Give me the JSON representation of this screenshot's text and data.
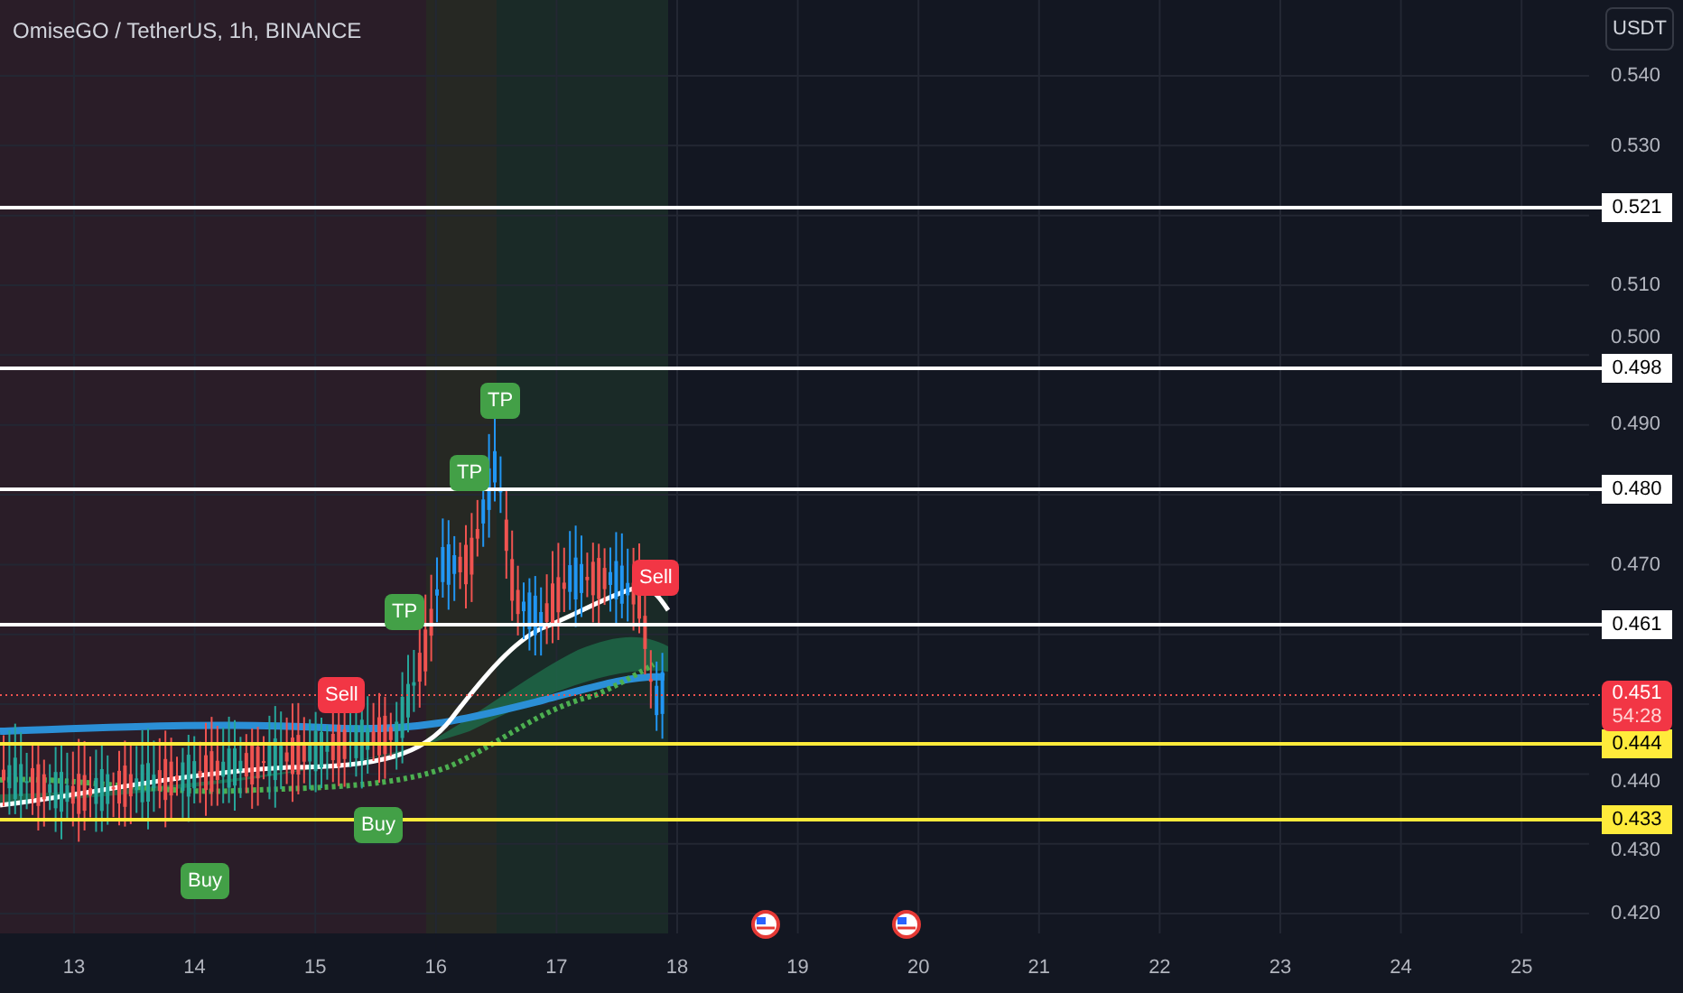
{
  "chart": {
    "title": "OmiseGO / TetherUS, 1h, BINANCE",
    "currency_button": "USDT",
    "price_ticks": [
      "0.540",
      "0.530",
      "0.510",
      "0.500",
      "0.490",
      "0.470",
      "0.440",
      "0.430",
      "0.420"
    ],
    "date_ticks": [
      "13",
      "14",
      "15",
      "16",
      "17",
      "18",
      "19",
      "20",
      "21",
      "22",
      "23",
      "24",
      "25"
    ],
    "levels": [
      {
        "label": "0.521",
        "color": "#ffffff"
      },
      {
        "label": "0.498",
        "color": "#ffffff"
      },
      {
        "label": "0.480",
        "color": "#ffffff"
      },
      {
        "label": "0.461",
        "color": "#ffffff"
      },
      {
        "label": "0.444",
        "color": "#ffeb3b"
      },
      {
        "label": "0.433",
        "color": "#ffeb3b"
      }
    ],
    "last_price": {
      "label": "0.451",
      "countdown": "54:28"
    },
    "signals": [
      {
        "kind": "buy",
        "label": "Buy"
      },
      {
        "kind": "sell",
        "label": "Sell"
      },
      {
        "kind": "buy",
        "label": "Buy"
      },
      {
        "kind": "tp",
        "label": "TP"
      },
      {
        "kind": "tp",
        "label": "TP"
      },
      {
        "kind": "tp",
        "label": "TP"
      },
      {
        "kind": "sell",
        "label": "Sell"
      }
    ]
  }
}
